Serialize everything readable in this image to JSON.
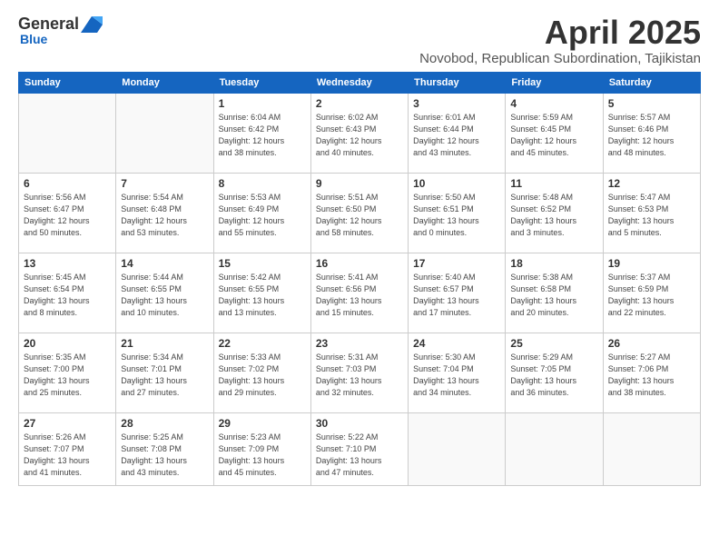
{
  "logo": {
    "general": "General",
    "blue": "Blue"
  },
  "title": {
    "month": "April 2025",
    "location": "Novobod, Republican Subordination, Tajikistan"
  },
  "headers": [
    "Sunday",
    "Monday",
    "Tuesday",
    "Wednesday",
    "Thursday",
    "Friday",
    "Saturday"
  ],
  "weeks": [
    [
      {
        "day": "",
        "info": ""
      },
      {
        "day": "",
        "info": ""
      },
      {
        "day": "1",
        "info": "Sunrise: 6:04 AM\nSunset: 6:42 PM\nDaylight: 12 hours\nand 38 minutes."
      },
      {
        "day": "2",
        "info": "Sunrise: 6:02 AM\nSunset: 6:43 PM\nDaylight: 12 hours\nand 40 minutes."
      },
      {
        "day": "3",
        "info": "Sunrise: 6:01 AM\nSunset: 6:44 PM\nDaylight: 12 hours\nand 43 minutes."
      },
      {
        "day": "4",
        "info": "Sunrise: 5:59 AM\nSunset: 6:45 PM\nDaylight: 12 hours\nand 45 minutes."
      },
      {
        "day": "5",
        "info": "Sunrise: 5:57 AM\nSunset: 6:46 PM\nDaylight: 12 hours\nand 48 minutes."
      }
    ],
    [
      {
        "day": "6",
        "info": "Sunrise: 5:56 AM\nSunset: 6:47 PM\nDaylight: 12 hours\nand 50 minutes."
      },
      {
        "day": "7",
        "info": "Sunrise: 5:54 AM\nSunset: 6:48 PM\nDaylight: 12 hours\nand 53 minutes."
      },
      {
        "day": "8",
        "info": "Sunrise: 5:53 AM\nSunset: 6:49 PM\nDaylight: 12 hours\nand 55 minutes."
      },
      {
        "day": "9",
        "info": "Sunrise: 5:51 AM\nSunset: 6:50 PM\nDaylight: 12 hours\nand 58 minutes."
      },
      {
        "day": "10",
        "info": "Sunrise: 5:50 AM\nSunset: 6:51 PM\nDaylight: 13 hours\nand 0 minutes."
      },
      {
        "day": "11",
        "info": "Sunrise: 5:48 AM\nSunset: 6:52 PM\nDaylight: 13 hours\nand 3 minutes."
      },
      {
        "day": "12",
        "info": "Sunrise: 5:47 AM\nSunset: 6:53 PM\nDaylight: 13 hours\nand 5 minutes."
      }
    ],
    [
      {
        "day": "13",
        "info": "Sunrise: 5:45 AM\nSunset: 6:54 PM\nDaylight: 13 hours\nand 8 minutes."
      },
      {
        "day": "14",
        "info": "Sunrise: 5:44 AM\nSunset: 6:55 PM\nDaylight: 13 hours\nand 10 minutes."
      },
      {
        "day": "15",
        "info": "Sunrise: 5:42 AM\nSunset: 6:55 PM\nDaylight: 13 hours\nand 13 minutes."
      },
      {
        "day": "16",
        "info": "Sunrise: 5:41 AM\nSunset: 6:56 PM\nDaylight: 13 hours\nand 15 minutes."
      },
      {
        "day": "17",
        "info": "Sunrise: 5:40 AM\nSunset: 6:57 PM\nDaylight: 13 hours\nand 17 minutes."
      },
      {
        "day": "18",
        "info": "Sunrise: 5:38 AM\nSunset: 6:58 PM\nDaylight: 13 hours\nand 20 minutes."
      },
      {
        "day": "19",
        "info": "Sunrise: 5:37 AM\nSunset: 6:59 PM\nDaylight: 13 hours\nand 22 minutes."
      }
    ],
    [
      {
        "day": "20",
        "info": "Sunrise: 5:35 AM\nSunset: 7:00 PM\nDaylight: 13 hours\nand 25 minutes."
      },
      {
        "day": "21",
        "info": "Sunrise: 5:34 AM\nSunset: 7:01 PM\nDaylight: 13 hours\nand 27 minutes."
      },
      {
        "day": "22",
        "info": "Sunrise: 5:33 AM\nSunset: 7:02 PM\nDaylight: 13 hours\nand 29 minutes."
      },
      {
        "day": "23",
        "info": "Sunrise: 5:31 AM\nSunset: 7:03 PM\nDaylight: 13 hours\nand 32 minutes."
      },
      {
        "day": "24",
        "info": "Sunrise: 5:30 AM\nSunset: 7:04 PM\nDaylight: 13 hours\nand 34 minutes."
      },
      {
        "day": "25",
        "info": "Sunrise: 5:29 AM\nSunset: 7:05 PM\nDaylight: 13 hours\nand 36 minutes."
      },
      {
        "day": "26",
        "info": "Sunrise: 5:27 AM\nSunset: 7:06 PM\nDaylight: 13 hours\nand 38 minutes."
      }
    ],
    [
      {
        "day": "27",
        "info": "Sunrise: 5:26 AM\nSunset: 7:07 PM\nDaylight: 13 hours\nand 41 minutes."
      },
      {
        "day": "28",
        "info": "Sunrise: 5:25 AM\nSunset: 7:08 PM\nDaylight: 13 hours\nand 43 minutes."
      },
      {
        "day": "29",
        "info": "Sunrise: 5:23 AM\nSunset: 7:09 PM\nDaylight: 13 hours\nand 45 minutes."
      },
      {
        "day": "30",
        "info": "Sunrise: 5:22 AM\nSunset: 7:10 PM\nDaylight: 13 hours\nand 47 minutes."
      },
      {
        "day": "",
        "info": ""
      },
      {
        "day": "",
        "info": ""
      },
      {
        "day": "",
        "info": ""
      }
    ]
  ]
}
